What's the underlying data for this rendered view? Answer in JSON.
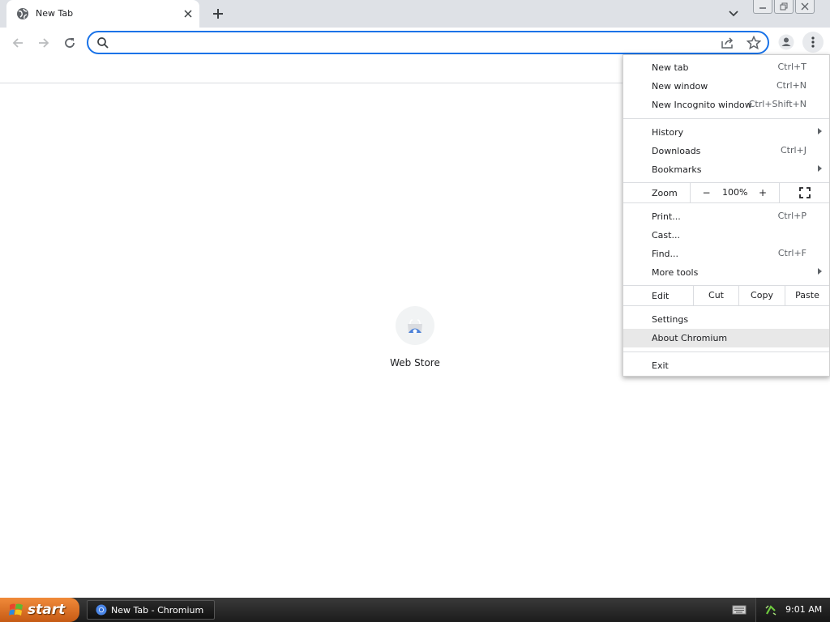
{
  "tab": {
    "title": "New Tab"
  },
  "omnibox": {
    "value": "",
    "placeholder": ""
  },
  "shortcut": {
    "label": "Web Store"
  },
  "menu": {
    "new_tab": {
      "label": "New tab",
      "shortcut": "Ctrl+T"
    },
    "new_window": {
      "label": "New window",
      "shortcut": "Ctrl+N"
    },
    "new_incognito": {
      "label": "New Incognito window",
      "shortcut": "Ctrl+Shift+N"
    },
    "history": {
      "label": "History"
    },
    "downloads": {
      "label": "Downloads",
      "shortcut": "Ctrl+J"
    },
    "bookmarks": {
      "label": "Bookmarks"
    },
    "zoom": {
      "label": "Zoom",
      "minus": "−",
      "value": "100%",
      "plus": "+"
    },
    "print": {
      "label": "Print...",
      "shortcut": "Ctrl+P"
    },
    "cast": {
      "label": "Cast..."
    },
    "find": {
      "label": "Find...",
      "shortcut": "Ctrl+F"
    },
    "more_tools": {
      "label": "More tools"
    },
    "edit": {
      "label": "Edit",
      "cut": "Cut",
      "copy": "Copy",
      "paste": "Paste"
    },
    "settings": {
      "label": "Settings"
    },
    "about": {
      "label": "About Chromium"
    },
    "exit": {
      "label": "Exit"
    }
  },
  "taskbar": {
    "start_label": "start",
    "task_label": "New Tab - Chromium",
    "clock": "9:01 AM"
  },
  "colors": {
    "accent": "#1a73e8",
    "menu_highlight": "#e8e8e8",
    "start_button": "#e0732a"
  }
}
